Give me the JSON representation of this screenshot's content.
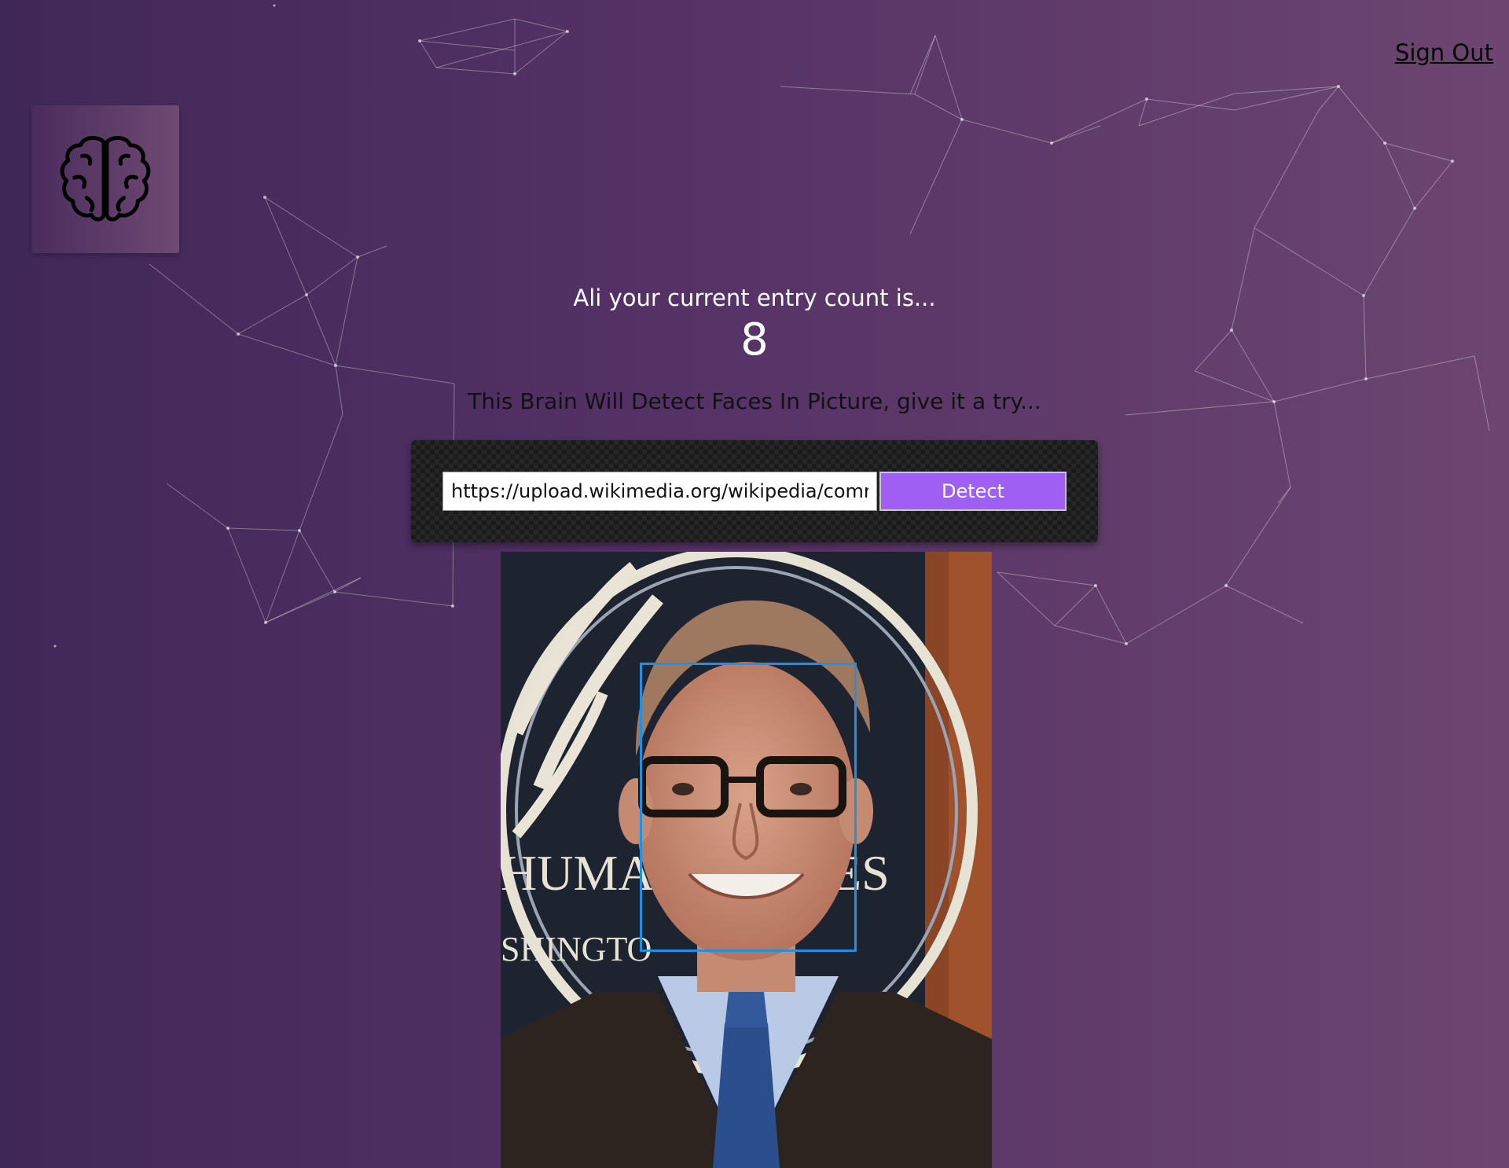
{
  "header": {
    "sign_out_label": "Sign Out"
  },
  "logo": {
    "icon": "brain-icon"
  },
  "rank": {
    "title": "Ali your current entry count is...",
    "count": "8"
  },
  "intro": {
    "tagline": "This Brain Will Detect Faces In Picture, give it a try..."
  },
  "form": {
    "url_value": "https://upload.wikimedia.org/wikipedia/commons",
    "detect_label": "Detect"
  },
  "result": {
    "face_box_color": "#1e90e6",
    "image_alt": "Detected face photo"
  },
  "colors": {
    "background_start": "#402858",
    "background_end": "#6c4670",
    "button": "#9f5ff2",
    "face_box": "#1e90e6"
  }
}
